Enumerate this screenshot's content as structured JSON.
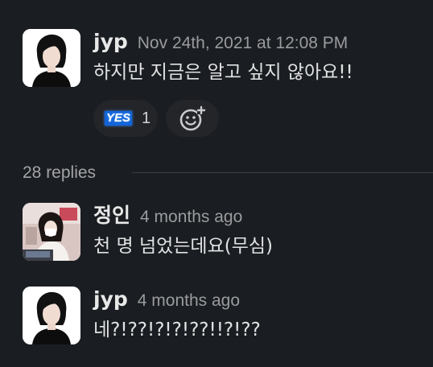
{
  "thread": {
    "parent": {
      "author": "jyp",
      "timestamp": "Nov 24th, 2021 at 12:08 PM",
      "text": "하지만 지금은 알고 싶지 않아요!!",
      "reactions": [
        {
          "emoji_label": "YES",
          "emoji_name": "yes-emoji",
          "count": "1"
        }
      ],
      "add_reaction_icon": "add-emoji-icon"
    },
    "replies_label": "28 replies",
    "replies": [
      {
        "author": "정인",
        "timestamp": "4 months ago",
        "text": "천 명 넘었는데요(무심)"
      },
      {
        "author": "jyp",
        "timestamp": "4 months ago",
        "text": "네?!??!?!?!??!!?!??"
      }
    ]
  },
  "colors": {
    "background": "#1a1d21",
    "text_primary": "#e1e2e3",
    "text_muted": "#9a9b9d",
    "reaction_bg": "#232529",
    "yes_emoji_bg": "#1264d8"
  }
}
